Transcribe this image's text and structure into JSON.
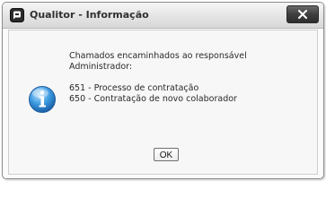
{
  "window": {
    "title": "Qualitor - Informação",
    "app_icon": "qualitor-logo-icon",
    "close_icon": "close-icon"
  },
  "dialog": {
    "icon": "info-icon",
    "message_lines": [
      "Chamados encaminhados ao responsável",
      "Administrador:"
    ],
    "tickets": [
      "651 - Processo de contratação",
      "650 - Contratação de novo colaborador"
    ],
    "ok_label": "OK"
  },
  "colors": {
    "info_blue": "#2e8fd6",
    "close_button": "#3f3f3f"
  }
}
